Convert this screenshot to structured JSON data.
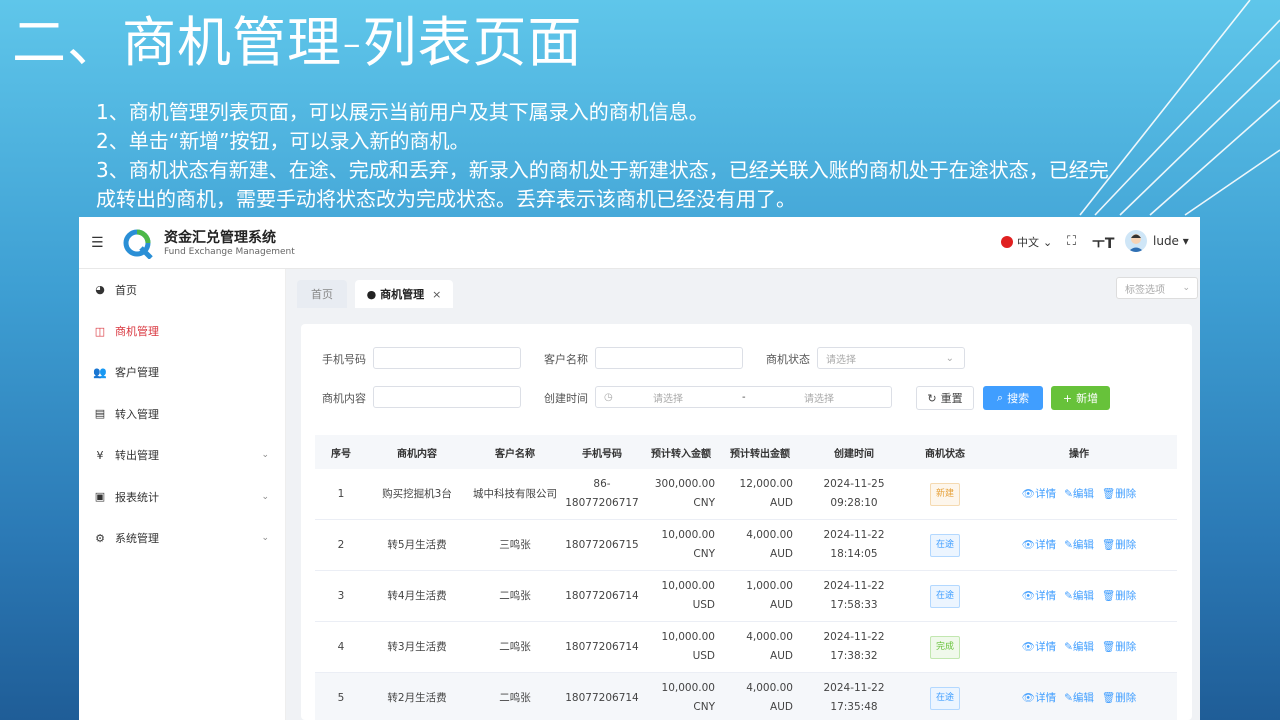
{
  "slide": {
    "title": "二、商机管理-列表页面",
    "notes": [
      "1、商机管理列表页面，可以展示当前用户及其下属录入的商机信息。",
      "2、单击“新增”按钮，可以录入新的商机。",
      "3、商机状态有新建、在途、完成和丢弃，新录入的商机处于新建状态，已经关联入账的商机处于在途状态，已经完成转出的商机，需要手动将状态改为完成状态。丢弃表示该商机已经没有用了。"
    ]
  },
  "app": {
    "brand": {
      "name": "资金汇兑管理系统",
      "subtitle": "Fund Exchange Management"
    },
    "header": {
      "language": "中文",
      "username": "lude"
    },
    "sidebar": [
      {
        "label": "首页",
        "icon": "dashboard-icon"
      },
      {
        "label": "商机管理",
        "icon": "table-icon"
      },
      {
        "label": "客户管理",
        "icon": "users-icon"
      },
      {
        "label": "转入管理",
        "icon": "copy-icon"
      },
      {
        "label": "转出管理",
        "icon": "yen-icon"
      },
      {
        "label": "报表统计",
        "icon": "monitor-icon"
      },
      {
        "label": "系统管理",
        "icon": "gear-icon"
      }
    ],
    "tabs": [
      {
        "label": "首页"
      },
      {
        "label": "● 商机管理"
      }
    ],
    "tag_select": "标签选项",
    "filters": {
      "phone_label": "手机号码",
      "customer_label": "客户名称",
      "status_label": "商机状态",
      "status_placeholder": "请选择",
      "content_label": "商机内容",
      "created_label": "创建时间",
      "date_start_placeholder": "请选择",
      "date_sep": "-",
      "date_end_placeholder": "请选择",
      "reset_label": "重置",
      "search_label": "搜索",
      "add_label": "新增"
    },
    "table": {
      "headers": [
        "序号",
        "商机内容",
        "客户名称",
        "手机号码",
        "预计转入金额",
        "预计转出金额",
        "创建时间",
        "商机状态",
        "操作"
      ],
      "actions": {
        "detail": "详情",
        "edit": "编辑",
        "delete": "删除"
      },
      "rows": [
        {
          "no": "1",
          "content": "购买挖掘机3台",
          "customer": "城中科技有限公司",
          "phone": "86-18077206717",
          "in_amount": "300,000.00",
          "in_cur": "CNY",
          "out_amount": "12,000.00",
          "out_cur": "AUD",
          "created": "2024-11-25 09:28:10",
          "status": "新建",
          "status_color": "#e6a23c"
        },
        {
          "no": "2",
          "content": "转5月生活费",
          "customer": "三鸣张",
          "phone": "18077206715",
          "in_amount": "10,000.00",
          "in_cur": "CNY",
          "out_amount": "4,000.00",
          "out_cur": "AUD",
          "created": "2024-11-22 18:14:05",
          "status": "在途",
          "status_color": "#409eff"
        },
        {
          "no": "3",
          "content": "转4月生活费",
          "customer": "二鸣张",
          "phone": "18077206714",
          "in_amount": "10,000.00",
          "in_cur": "USD",
          "out_amount": "1,000.00",
          "out_cur": "AUD",
          "created": "2024-11-22 17:58:33",
          "status": "在途",
          "status_color": "#409eff"
        },
        {
          "no": "4",
          "content": "转3月生活费",
          "customer": "二鸣张",
          "phone": "18077206714",
          "in_amount": "10,000.00",
          "in_cur": "USD",
          "out_amount": "4,000.00",
          "out_cur": "AUD",
          "created": "2024-11-22 17:38:32",
          "status": "完成",
          "status_color": "#67c23a"
        },
        {
          "no": "5",
          "content": "转2月生活费",
          "customer": "二鸣张",
          "phone": "18077206714",
          "in_amount": "10,000.00",
          "in_cur": "CNY",
          "out_amount": "4,000.00",
          "out_cur": "AUD",
          "created": "2024-11-22 17:35:48",
          "status": "在途",
          "status_color": "#409eff"
        }
      ]
    }
  }
}
